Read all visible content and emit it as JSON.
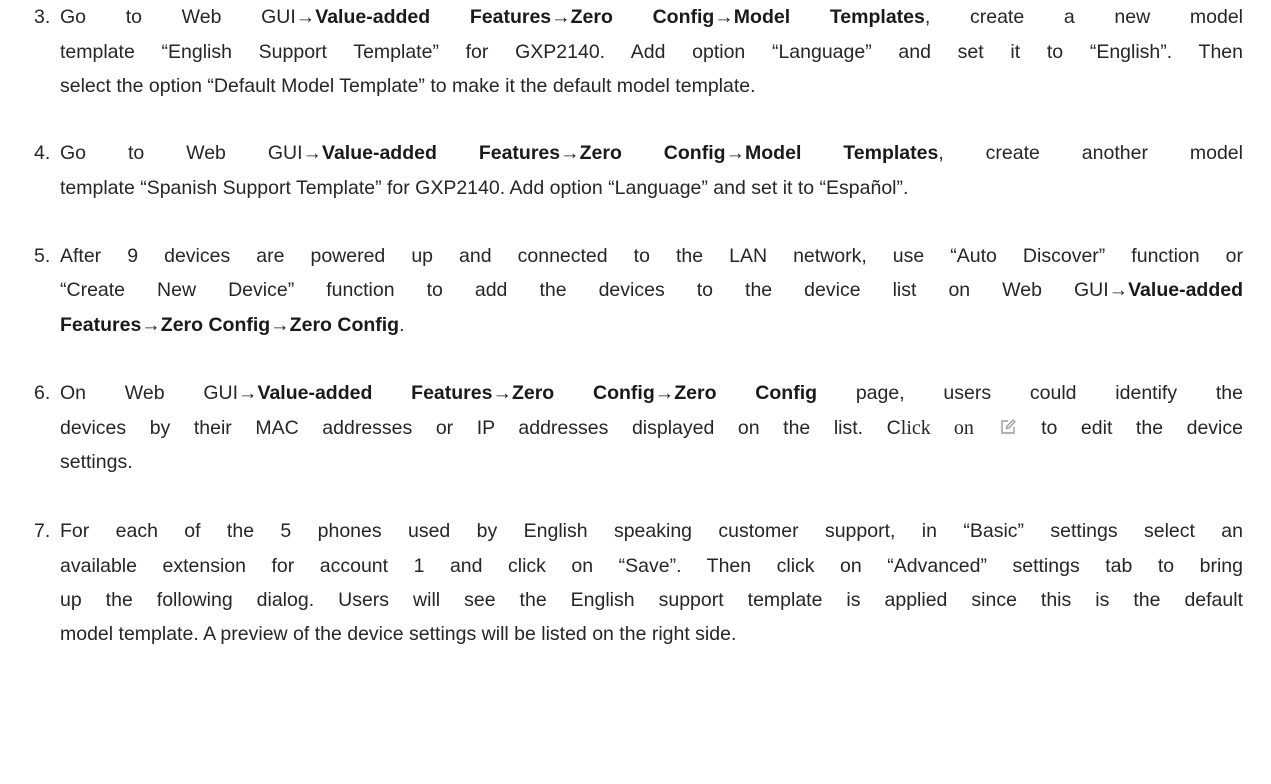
{
  "steps": [
    {
      "number": "3.",
      "lines": [
        [
          "Go to Web GUI→",
          {
            "b": "Value-added Features→Zero Config→Model Templates"
          },
          ", create a new model"
        ],
        [
          "template “English Support Template” for GXP2140. Add option “Language” and set it to “English”. Then"
        ],
        [
          "select the option “Default Model Template” to make it the default model template."
        ]
      ]
    },
    {
      "number": "4.",
      "lines": [
        [
          "Go to Web GUI→",
          {
            "b": "Value-added Features→Zero Config→Model Templates"
          },
          ", create another model"
        ],
        [
          "template “Spanish Support Template” for GXP2140. Add option “Language” and set it to “Español”."
        ]
      ]
    },
    {
      "number": "5.",
      "lines": [
        [
          "After 9 devices are powered up and connected to the LAN network, use “Auto Discover” function or"
        ],
        [
          "“Create New Device” function to add the devices to the device list on Web GUI→",
          {
            "b": "Value-added"
          }
        ],
        [
          {
            "b": "Features→Zero Config→Zero Config"
          },
          "."
        ]
      ]
    },
    {
      "number": "6.",
      "lines": [
        [
          "On Web GUI→",
          {
            "b": "Value-added Features→Zero Config→Zero Config"
          },
          " page, users could identify the"
        ],
        [
          "devices by their MAC addresses or IP addresses displayed on the list. C",
          {
            "serif": "lick on"
          },
          " ",
          {
            "icon": "edit-icon"
          },
          " to edit the device"
        ],
        [
          "settings."
        ]
      ]
    },
    {
      "number": "7.",
      "lines": [
        [
          "For each of the 5 phones used by English speaking customer support, in “Basic” settings select an"
        ],
        [
          "available extension for account 1 and click on “Save”. Then click on “Advanced” settings tab to bring"
        ],
        [
          "up the following dialog. Users will see the English support template is applied since this is the default"
        ],
        [
          "model template. A preview of the device settings will be listed on the right side."
        ]
      ]
    }
  ],
  "colors": {
    "text": "#262626",
    "icon": "#9a9a9a"
  }
}
